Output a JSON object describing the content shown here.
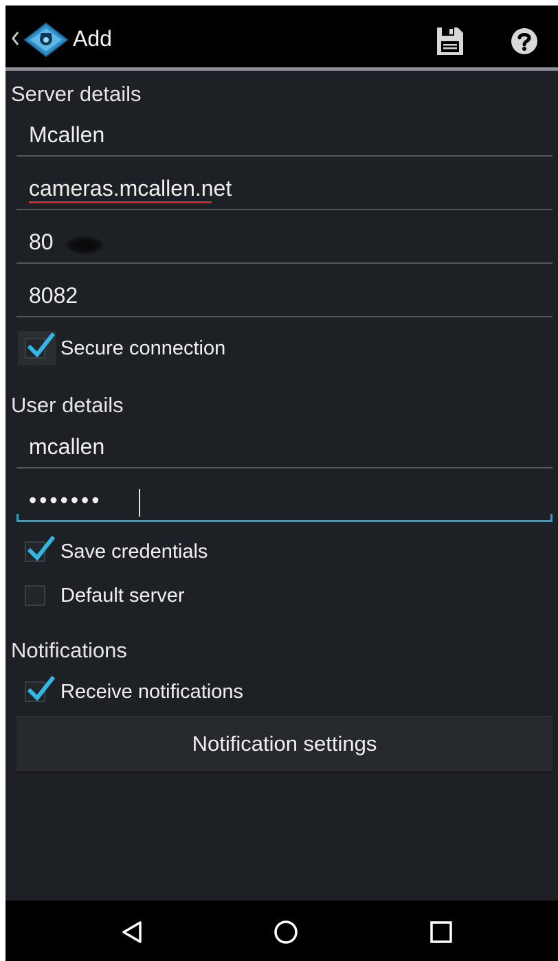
{
  "actionbar": {
    "title": "Add",
    "icons": {
      "up": "chevron-left-icon",
      "logo": "app-logo-icon",
      "save": "save-icon",
      "help": "help-icon"
    }
  },
  "server_details": {
    "title": "Server details",
    "name": "Mcallen",
    "host": "cameras.mcallen.net",
    "port": "80",
    "secure_port": "8082",
    "secure_connection": {
      "label": "Secure connection",
      "checked": true
    }
  },
  "user_details": {
    "title": "User details",
    "username": "mcallen",
    "password_masked": "•••••••",
    "save_credentials": {
      "label": "Save credentials",
      "checked": true
    },
    "default_server": {
      "label": "Default server",
      "checked": false
    }
  },
  "notifications": {
    "title": "Notifications",
    "receive_notifications": {
      "label": "Receive notifications",
      "checked": true
    },
    "settings_button": "Notification settings"
  },
  "navbar": {
    "icons": [
      "back-icon",
      "home-icon",
      "recents-icon"
    ]
  },
  "colors": {
    "accent": "#2fa0d2",
    "background": "#1d2024",
    "actionbar": "#000000",
    "spellcheck": "#d9262b"
  }
}
